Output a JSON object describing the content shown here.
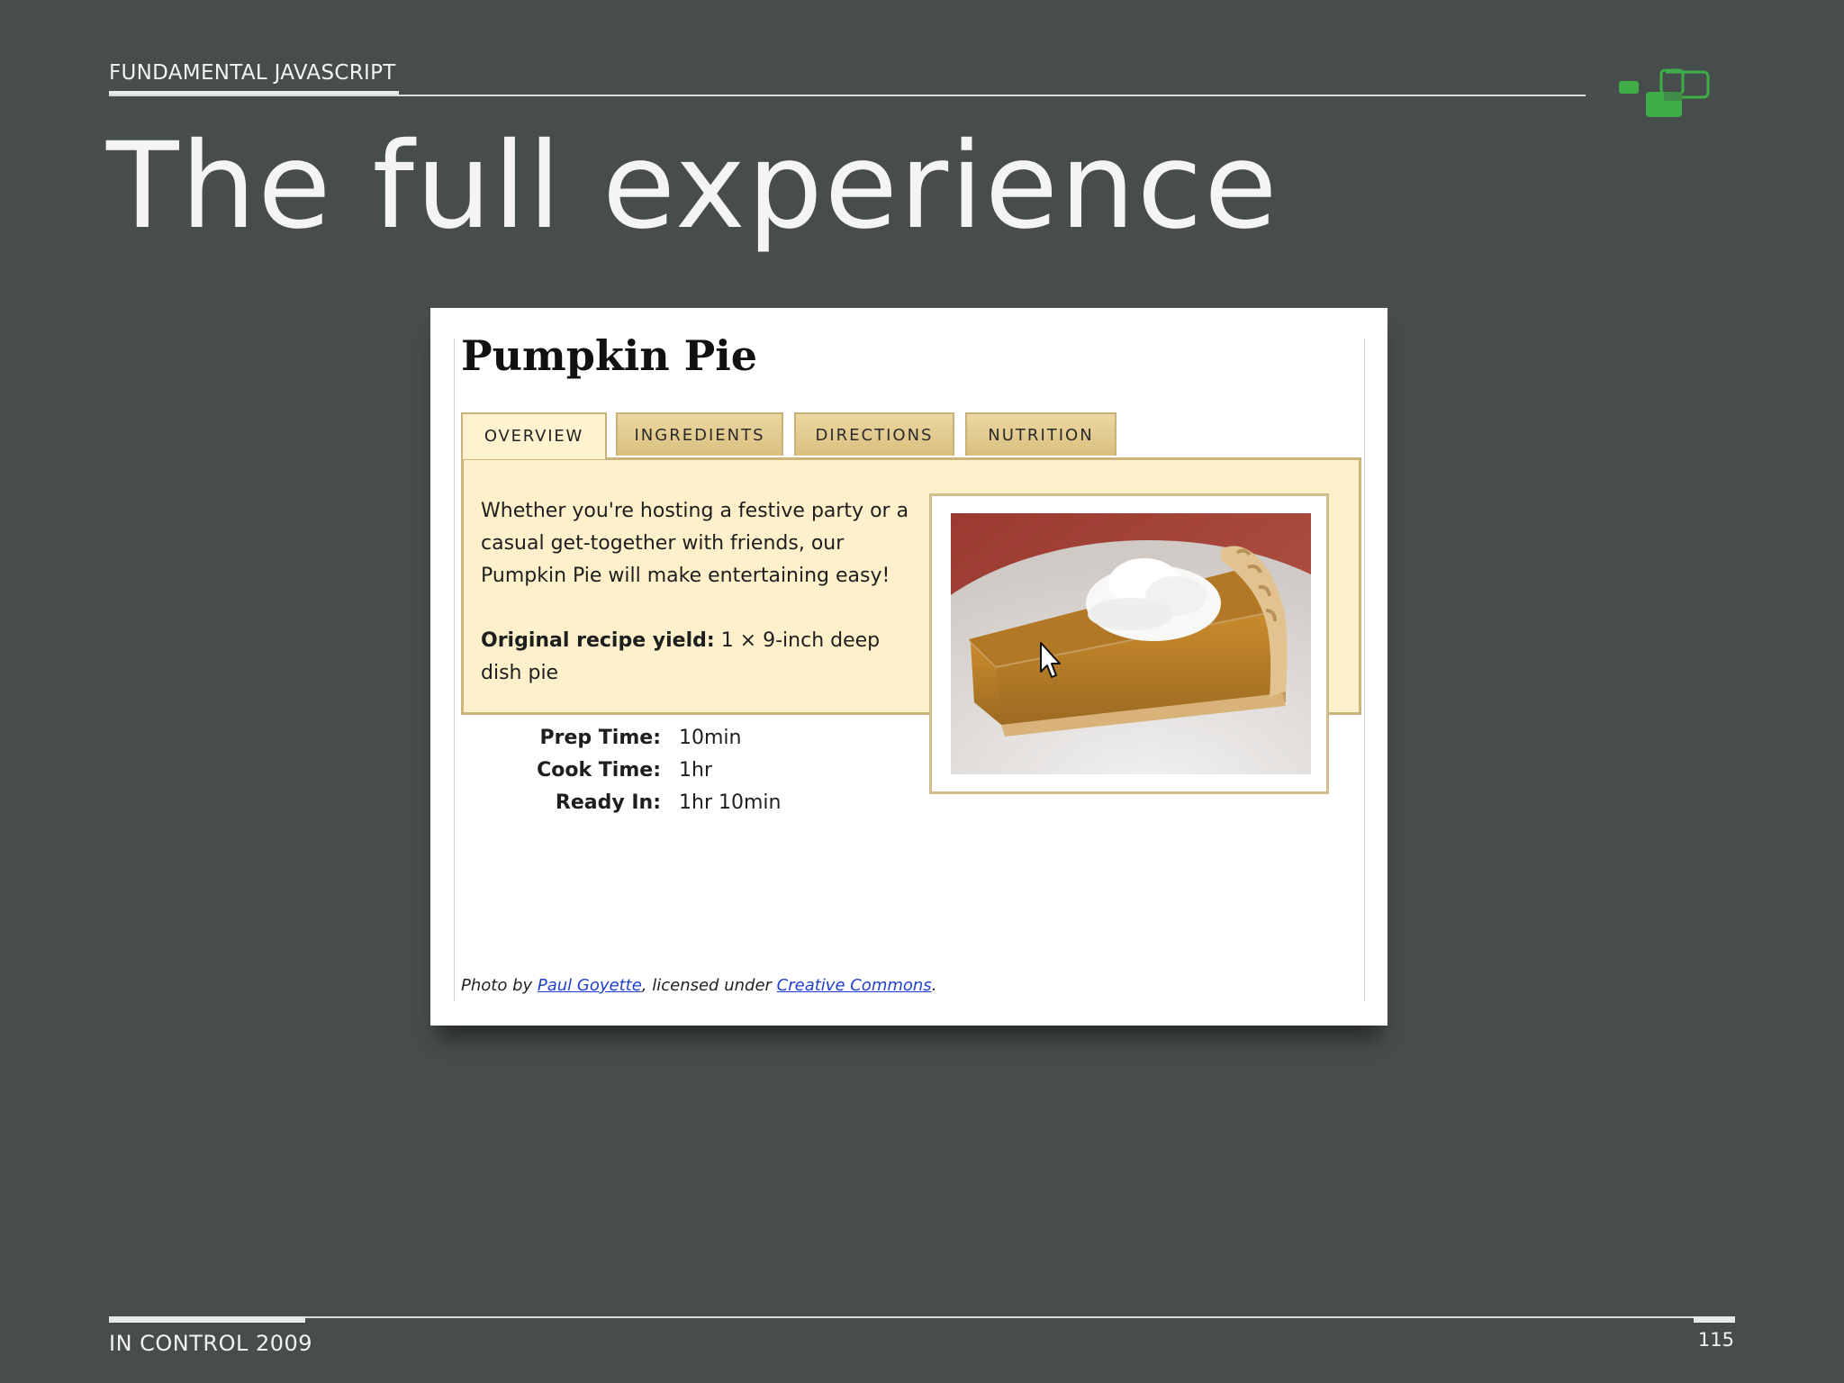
{
  "slide": {
    "header_label": "FUNDAMENTAL JAVASCRIPT",
    "title": "The full experience",
    "footer_label": "IN CONTROL 2009",
    "page_number": "115"
  },
  "recipe": {
    "title": "Pumpkin Pie",
    "tabs": [
      {
        "label": "OVERVIEW",
        "active": true
      },
      {
        "label": "INGREDIENTS",
        "active": false
      },
      {
        "label": "DIRECTIONS",
        "active": false
      },
      {
        "label": "NUTRITION",
        "active": false
      }
    ],
    "description": "Whether you're hosting a festive party or a casual get-together with friends, our Pumpkin Pie will make entertaining easy!",
    "yield_label": "Original recipe yield",
    "yield_value": "1 × 9-inch deep dish pie",
    "times": [
      {
        "label": "Prep Time:",
        "value": "10min"
      },
      {
        "label": "Cook Time:",
        "value": "1hr"
      },
      {
        "label": "Ready In:",
        "value": "1hr 10min"
      }
    ],
    "credit": {
      "prefix": "Photo by ",
      "author": "Paul Goyette",
      "middle": ", licensed under ",
      "license": "Creative Commons",
      "suffix": "."
    }
  },
  "colors": {
    "slide_bg": "#474c4c",
    "logo_green": "#3fae49",
    "panel_bg": "#fff0cc",
    "tab_bg": "#e3cb8e",
    "link": "#1f3fcf"
  }
}
